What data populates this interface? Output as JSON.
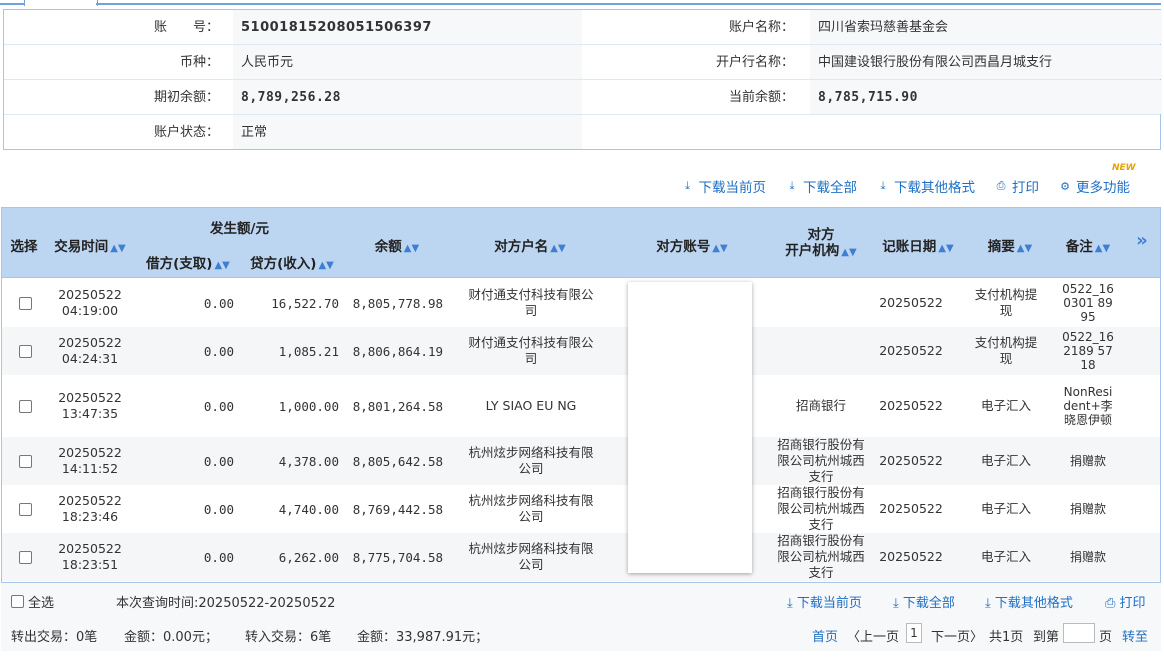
{
  "account": {
    "account_no_label": "账　　号：",
    "account_no": "51001815208051506397",
    "account_name_label": "账户名称：",
    "account_name": "四川省索玛慈善基金会",
    "currency_label": "币种：",
    "currency": "人民币元",
    "bank_label": "开户行名称：",
    "bank": "中国建设银行股份有限公司西昌月城支行",
    "opening_balance_label": "期初余额：",
    "opening_balance": "8,789,256.28",
    "current_balance_label": "当前余额：",
    "current_balance": "8,785,715.90",
    "status_label": "账户状态：",
    "status": "正常"
  },
  "toolbar": {
    "download_page": "下载当前页",
    "download_all": "下载全部",
    "download_other": "下载其他格式",
    "print": "打印",
    "more": "更多功能",
    "new_badge": "NEW"
  },
  "table": {
    "headers": {
      "select": "选择",
      "time": "交易时间",
      "amount_group": "发生额/元",
      "debit": "借方(支取)",
      "credit": "贷方(收入)",
      "balance": "余额",
      "party_name": "对方户名",
      "party_account": "对方账号",
      "party_bank_line1": "对方",
      "party_bank_line2": "开户机构",
      "post_date": "记账日期",
      "summary": "摘要",
      "remark": "备注",
      "more": "»"
    },
    "rows": [
      {
        "date": "20250522",
        "time": "04:19:00",
        "debit": "0.00",
        "credit": "16,522.70",
        "balance": "8,805,778.98",
        "party": "财付通支付科技有限公司",
        "bank": "",
        "post_date": "20250522",
        "summary": "支付机构提现",
        "remark": "0522_160301 8995"
      },
      {
        "date": "20250522",
        "time": "04:24:31",
        "debit": "0.00",
        "credit": "1,085.21",
        "balance": "8,806,864.19",
        "party": "财付通支付科技有限公司",
        "bank": "",
        "post_date": "20250522",
        "summary": "支付机构提现",
        "remark": "0522_162189 5718"
      },
      {
        "date": "20250522",
        "time": "13:47:35",
        "debit": "0.00",
        "credit": "1,000.00",
        "balance": "8,801,264.58",
        "party": "LY SIAO EU NG",
        "bank": "招商银行",
        "post_date": "20250522",
        "summary": "电子汇入",
        "remark": "NonResident+李晓恩伊顿"
      },
      {
        "date": "20250522",
        "time": "14:11:52",
        "debit": "0.00",
        "credit": "4,378.00",
        "balance": "8,805,642.58",
        "party": "杭州炫步网络科技有限公司",
        "bank": "招商银行股份有限公司杭州城西支行",
        "post_date": "20250522",
        "summary": "电子汇入",
        "remark": "捐赠款"
      },
      {
        "date": "20250522",
        "time": "18:23:46",
        "debit": "0.00",
        "credit": "4,740.00",
        "balance": "8,769,442.58",
        "party": "杭州炫步网络科技有限公司",
        "bank": "招商银行股份有限公司杭州城西支行",
        "post_date": "20250522",
        "summary": "电子汇入",
        "remark": "捐赠款"
      },
      {
        "date": "20250522",
        "time": "18:23:51",
        "debit": "0.00",
        "credit": "6,262.00",
        "balance": "8,775,704.58",
        "party": "杭州炫步网络科技有限公司",
        "bank": "招商银行股份有限公司杭州城西支行",
        "post_date": "20250522",
        "summary": "电子汇入",
        "remark": "捐赠款"
      }
    ]
  },
  "footer": {
    "select_all": "全选",
    "query_time": "本次查询时间:20250522-20250522",
    "download_page": "下载当前页",
    "download_all": "下载全部",
    "download_other": "下载其他格式",
    "print": "打印",
    "out_count": "转出交易：0笔",
    "out_amount": "金额：0.00元；",
    "in_count": "转入交易：6笔",
    "in_amount": "金额：33,987.91元；",
    "first": "首页",
    "prev": "〈上一页",
    "page": "1",
    "next": "下一页〉",
    "total": "共1页",
    "goto_prefix": "到第",
    "goto_suffix": "页",
    "go": "转至"
  }
}
